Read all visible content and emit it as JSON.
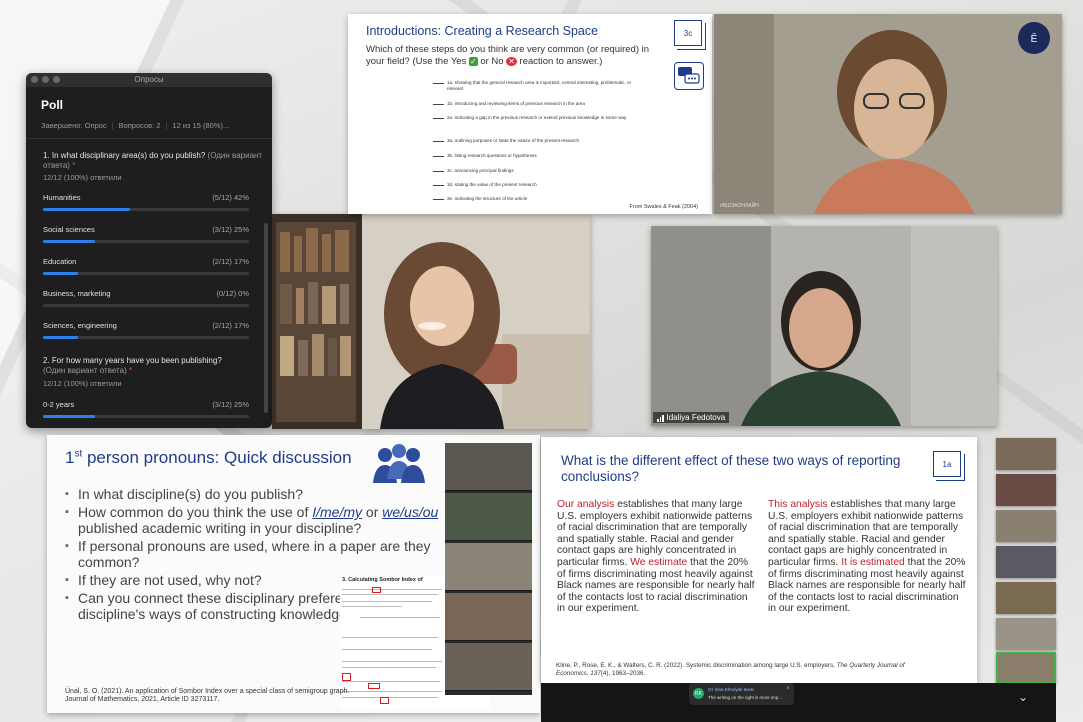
{
  "poll": {
    "window_title": "Опросы",
    "title": "Poll",
    "status": "Завершено: Опрос",
    "questions_count": "Вопросов: 2",
    "progress": "12 из 15 (80%)...",
    "q1": {
      "text": "1. In what disciplinary area(s) do you publish?",
      "kind": "(Один вариант ответа)",
      "required": "*",
      "answered": "12/12 (100%) ответили",
      "options": [
        {
          "label": "Humanities",
          "value": "(5/12) 42%",
          "pct": 42
        },
        {
          "label": "Social sciences",
          "value": "(3/12) 25%",
          "pct": 25
        },
        {
          "label": "Education",
          "value": "(2/12) 17%",
          "pct": 17
        },
        {
          "label": "Business, marketing",
          "value": "(0/12) 0%",
          "pct": 0
        },
        {
          "label": "Sciences, engineering",
          "value": "(2/12) 17%",
          "pct": 17
        }
      ]
    },
    "q2": {
      "text": "2. For how many years have you been publishing?",
      "kind": "(Один вариант ответа)",
      "required": "*",
      "answered": "12/12 (100%) ответили",
      "options": [
        {
          "label": "0-2 years",
          "value": "(3/12) 25%",
          "pct": 25
        }
      ]
    },
    "accent": "#2e7ef0"
  },
  "slide_top": {
    "title": "Introductions: Creating a Research Space",
    "question_pre": "Which of these steps do you think are very common (or required) in your field? (Use the Yes",
    "question_mid": "or No",
    "question_post": "reaction to answer.)",
    "badge": "3c",
    "steps": [
      "1a. showing that the general research area is important, central interesting, problematic, or relevant",
      "1b. introducing and reviewing items of previous research in the area",
      "2a. indicating a gap in the previous research or extend previous knowledge in some way",
      "3a. outlining purposes or state the nature of the present research",
      "3b. listing research questions or hypotheses",
      "3c. announcing principal findings",
      "3d. stating the value of the present research",
      "3e. indicating the structure of the article"
    ],
    "source": "From Swales & Feak (2004)"
  },
  "video_main": {},
  "video_top_right": {
    "watermark": "#ВШЭАОНЛАЙН"
  },
  "video_idaliya": {
    "name": "Idaliya Fedotova"
  },
  "slide_bl": {
    "title_pre": "1",
    "title_sup": "st",
    "title_post": " person pronouns: Quick discussion",
    "bullets": [
      {
        "text": "In what discipline(s) do you publish?"
      },
      {
        "pre": "How common do you think the use of ",
        "it1": "I/me/my",
        "mid": " or ",
        "it2": "we/us/ou",
        "post": " published academic writing in your discipline?"
      },
      {
        "text": "If personal pronouns are used, where in a paper are they common?"
      },
      {
        "text": "If they are not used, why not?"
      },
      {
        "text": "Can you connect these disciplinary preferences to your discipline's ways of constructing knowledge?"
      }
    ],
    "reference": "Ünal, S. O. (2021). An application of Sombor Index over a special class of semigroup graph. Journal of Mathematics, 2021, Article ID 3273117.",
    "paper_heading": "3. Calculating Sombor Index of"
  },
  "slide_br": {
    "title": "What is the different effect of these two ways of reporting conclusions?",
    "badge": "1a",
    "left": {
      "red1": "Our analysis",
      "text1": " establishes that many large U.S. employers exhibit nationwide patterns of racial discrimination that are temporally and spatially stable. Racial and gender contact gaps are highly concentrated in particular firms. ",
      "red2": "We estimate",
      "text2": " that the 20% of firms discriminating most heavily against Black names are responsible for nearly half of the contacts lost to racial discrimination in our experiment."
    },
    "right": {
      "red1": "This analysis",
      "text1": " establishes that many large U.S. employers exhibit nationwide patterns of racial discrimination that are temporally and spatially stable. Racial and gender contact gaps are highly concentrated in particular firms. ",
      "red2": "It is estimated",
      "text2": " that the 20% of firms discriminating most heavily against Black names are responsible for nearly half of the contacts lost to racial discrimination in our experiment."
    },
    "ref_pre": "Kline, P., Rose, E. K., & Walters, C. R. (2022). Systemic discrimination among large U.S. employers, ",
    "ref_journal": "The Quarterly Journal of Economics, 137",
    "ref_post": "(4), 1963–2036."
  },
  "toast": {
    "avatar": "RK",
    "from": "От Irina Khrulyak всем",
    "message": "The writing on the right is more imp...",
    "close": "×"
  },
  "icons": {
    "chevron": "chevron-down-icon",
    "close": "close-icon",
    "signal": "signal-icon"
  },
  "colors": {
    "slide_blue": "#1f3c88",
    "red": "#c0202a",
    "selected_green": "#3fb24a"
  }
}
